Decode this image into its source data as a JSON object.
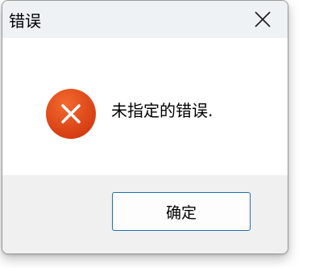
{
  "window": {
    "title": "错误"
  },
  "dialog": {
    "message": "未指定的错误.",
    "icon": "error-icon",
    "ok_label": "确定"
  },
  "colors": {
    "titlebar_bg": "#eef2f5",
    "footer_bg": "#f0f0f0",
    "error_icon": "#e04a17",
    "button_border": "#1d6fb8"
  }
}
